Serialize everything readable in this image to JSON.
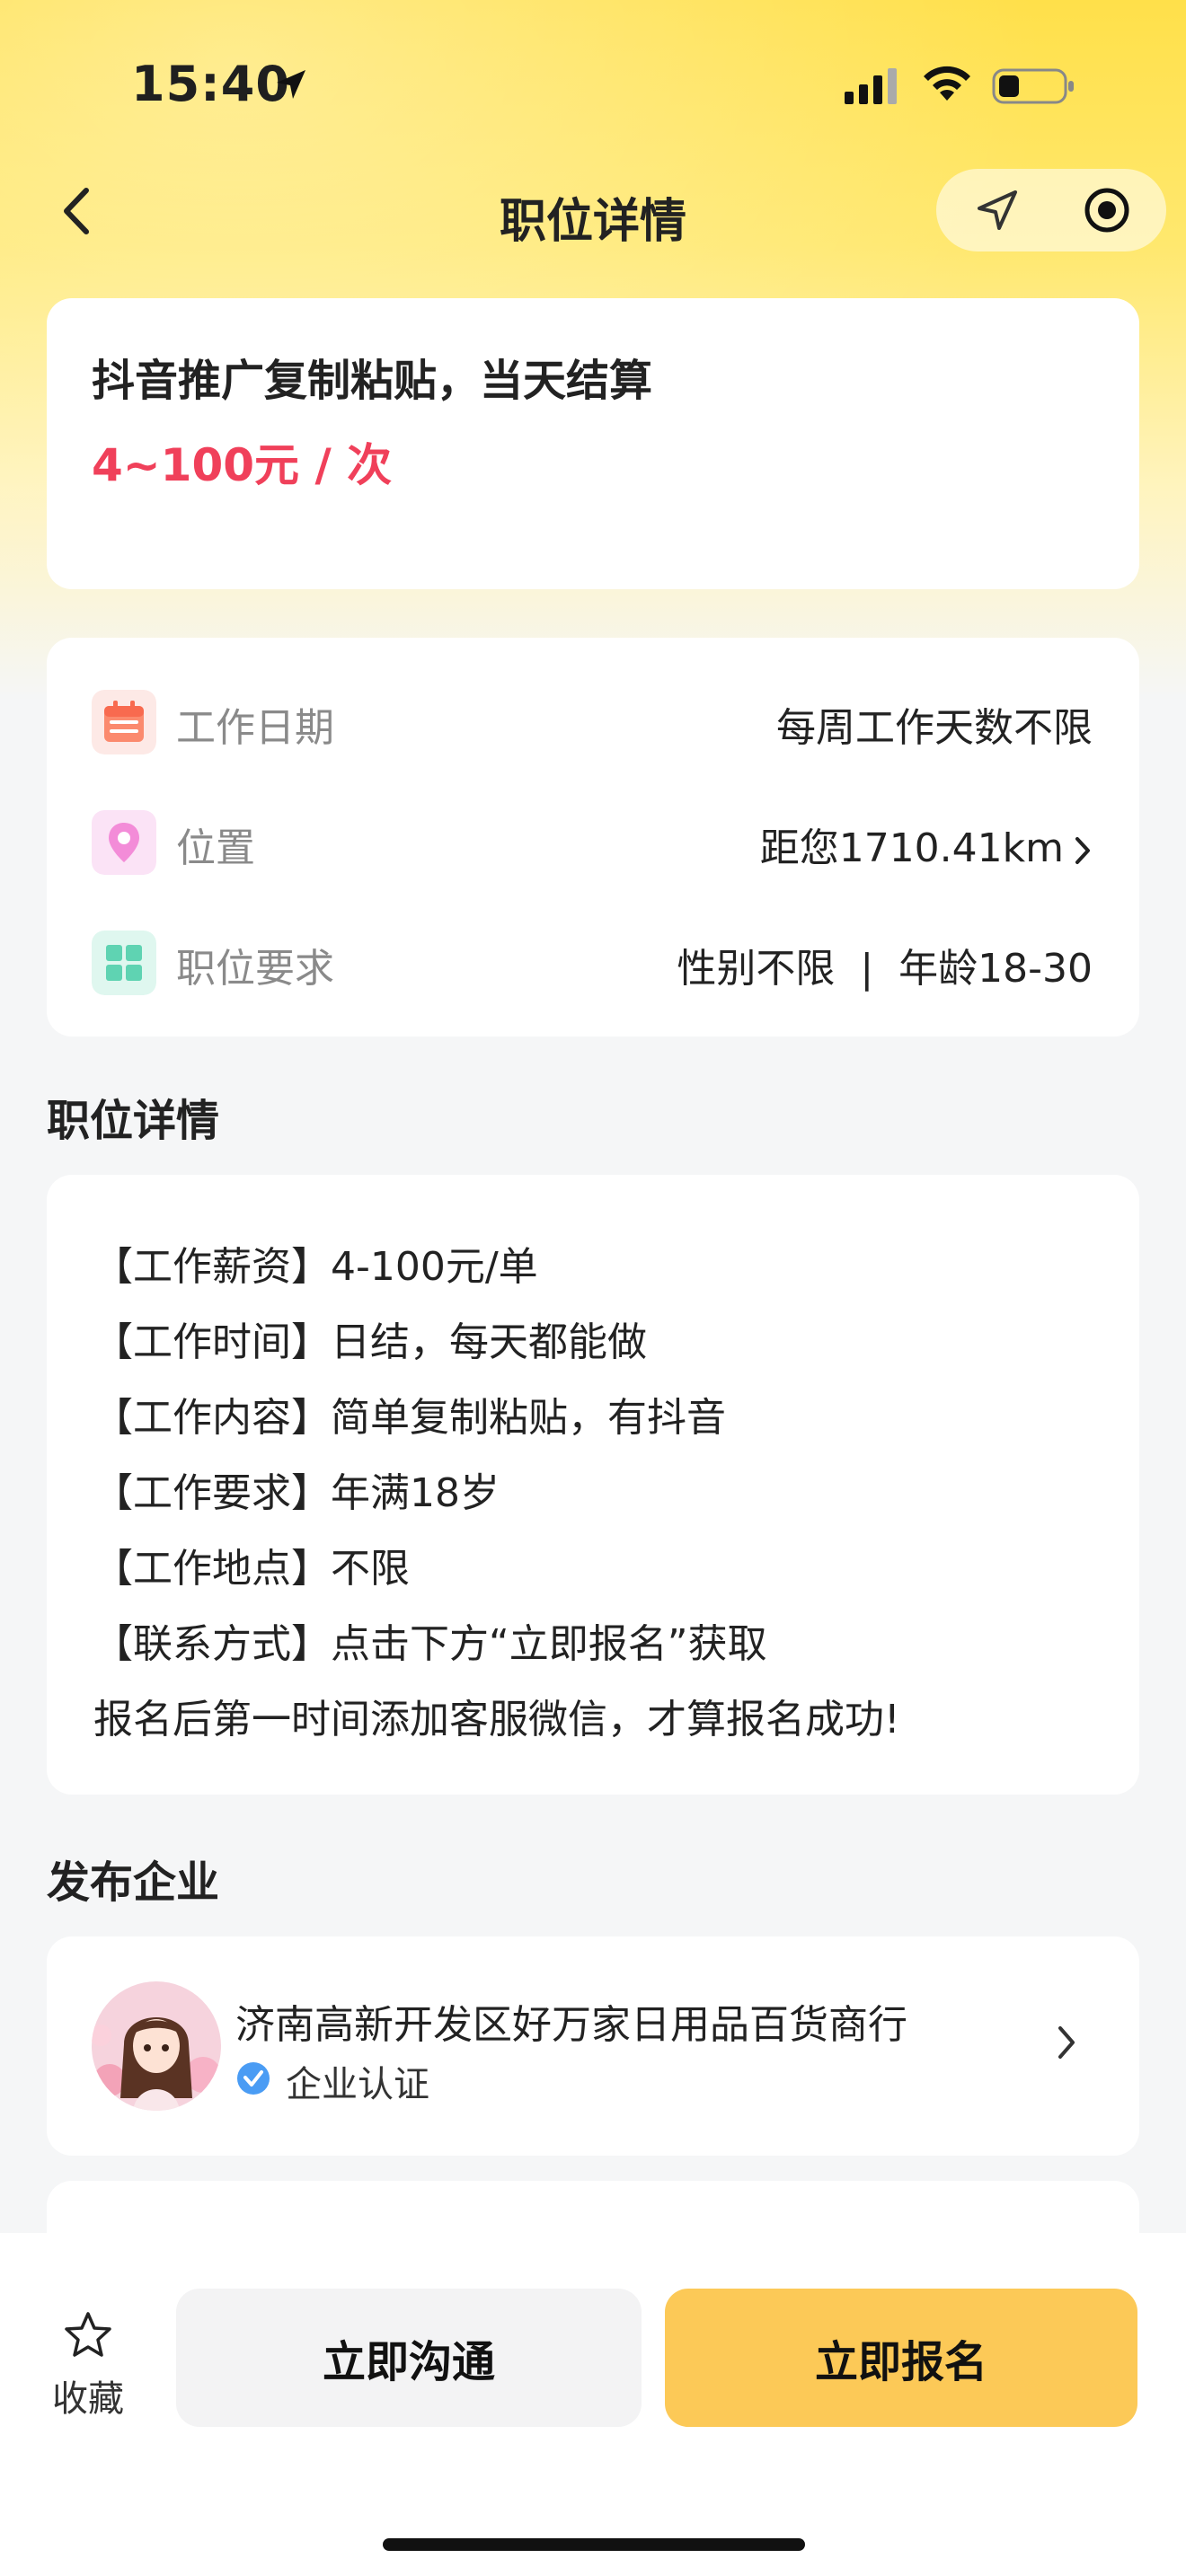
{
  "status_bar": {
    "time": "15:40"
  },
  "nav": {
    "title": "职位详情"
  },
  "job": {
    "title": "抖音推广复制粘贴，当天结算",
    "salary": "4~100元 / 次"
  },
  "info_rows": [
    {
      "label": "工作日期",
      "value": "每周工作天数不限",
      "icon": "calendar-icon"
    },
    {
      "label": "位置",
      "value": "距您1710.41km",
      "icon": "location-pin-icon"
    },
    {
      "label": "职位要求",
      "value": "性别不限  |  年龄18-30",
      "icon": "grid-icon"
    }
  ],
  "details": {
    "section_title": "职位详情",
    "lines": [
      "【工作薪资】4-100元/单",
      "【工作时间】日结，每天都能做",
      "【工作内容】简单复制粘贴，有抖音",
      "【工作要求】年满18岁",
      "【工作地点】不限",
      "【联系方式】点击下方“立即报名”获取",
      "报名后第一时间添加客服微信，才算报名成功!"
    ]
  },
  "company": {
    "section_title": "发布企业",
    "name": "济南高新开发区好万家日用品百货商行",
    "verified_label": "企业认证"
  },
  "bottom_bar": {
    "favorite_label": "收藏",
    "chat_label": "立即沟通",
    "apply_label": "立即报名"
  },
  "colors": {
    "accent_yellow": "#fcc957",
    "salary_red": "#f0405a",
    "header_yellow": "#ffe04a"
  }
}
